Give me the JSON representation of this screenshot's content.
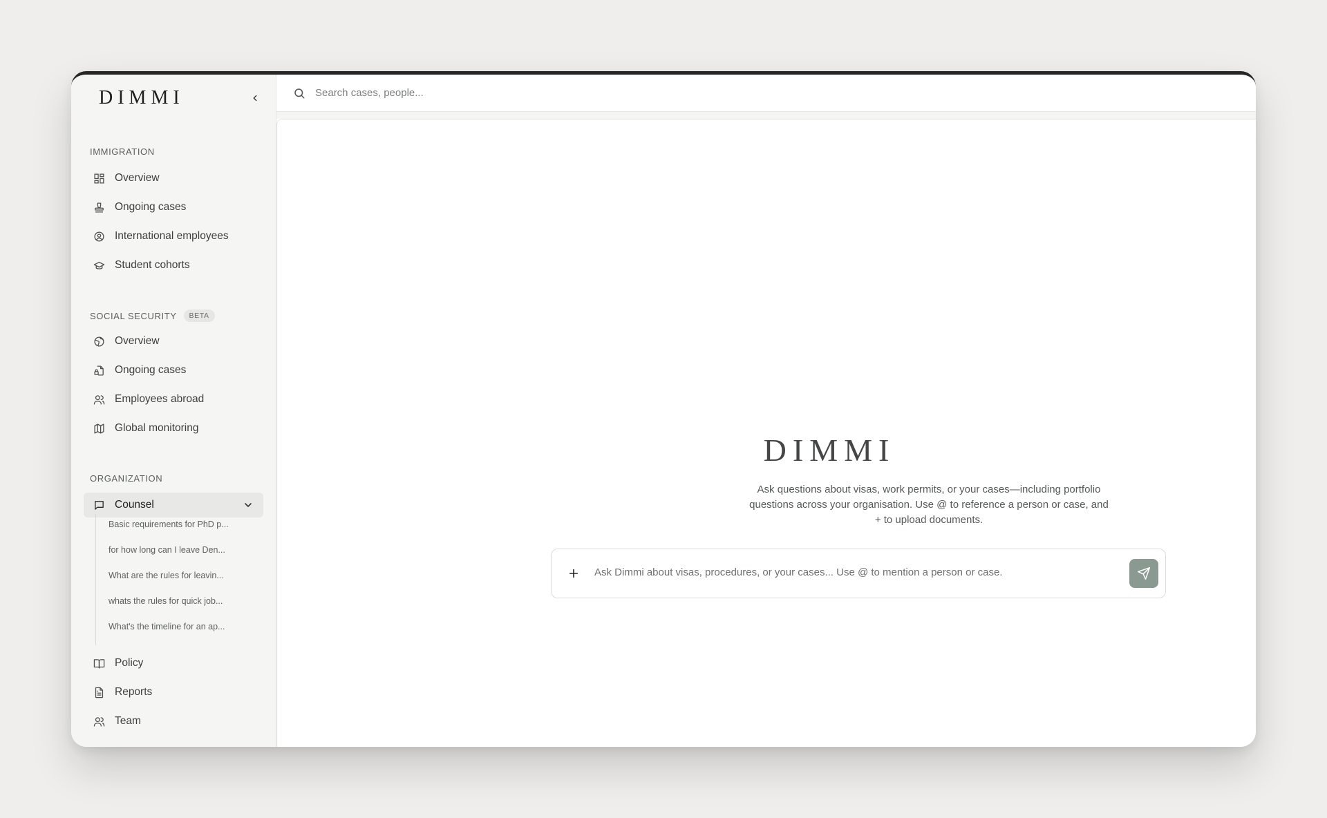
{
  "app": {
    "brand": "DIMMI"
  },
  "search": {
    "placeholder": "Search cases, people..."
  },
  "sidebar": {
    "immigration": {
      "label": "IMMIGRATION",
      "items": [
        {
          "label": "Overview",
          "icon": "grid-icon"
        },
        {
          "label": "Ongoing cases",
          "icon": "stamp-icon"
        },
        {
          "label": "International employees",
          "icon": "user-circle-icon"
        },
        {
          "label": "Student cohorts",
          "icon": "graduation-cap-icon"
        }
      ]
    },
    "social_security": {
      "label": "SOCIAL SECURITY",
      "badge": "BETA",
      "items": [
        {
          "label": "Overview",
          "icon": "globe-icon"
        },
        {
          "label": "Ongoing cases",
          "icon": "file-lock-icon"
        },
        {
          "label": "Employees abroad",
          "icon": "users-icon"
        },
        {
          "label": "Global monitoring",
          "icon": "map-icon"
        }
      ]
    },
    "organization": {
      "label": "ORGANIZATION",
      "counsel": {
        "label": "Counsel",
        "icon": "message-square-icon",
        "expanded": true,
        "conversations": [
          "Basic requirements for PhD p...",
          "for how long can I leave Den...",
          "What are the rules for leavin...",
          "whats the rules for quick job...",
          "What's the timeline for an ap..."
        ]
      },
      "items": [
        {
          "label": "Policy",
          "icon": "book-open-icon"
        },
        {
          "label": "Reports",
          "icon": "file-text-icon"
        },
        {
          "label": "Team",
          "icon": "users-icon"
        }
      ]
    }
  },
  "main": {
    "hero_brand": "DIMMI",
    "description": "Ask questions about visas, work permits, or your cases—including portfolio questions across your organisation. Use @ to reference a person or case, and + to upload documents.",
    "composer": {
      "placeholder": "Ask Dimmi about visas, procedures, or your cases... Use @ to mention a person or case.",
      "add_icon": "plus-icon",
      "send_icon": "send-icon"
    }
  },
  "colors": {
    "background": "#efeeec",
    "sidebar": "#f5f5f4",
    "send_button": "#8a9a91",
    "window_top_bar": "#262626"
  }
}
